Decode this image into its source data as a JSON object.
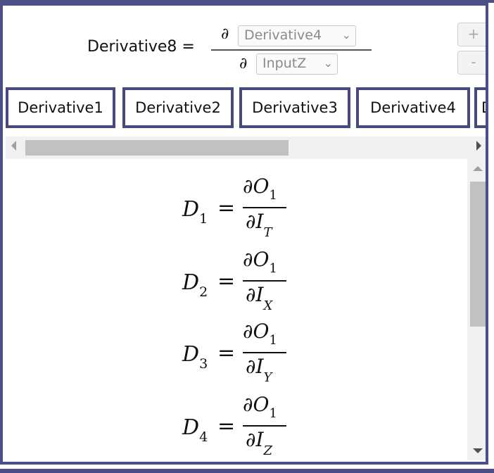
{
  "definition": {
    "name": "Derivative8 =",
    "partial_symbol": "∂",
    "numerator_select": "Derivative4",
    "denominator_select": "InputZ",
    "add_label": "+",
    "remove_label": "-"
  },
  "tabs": [
    {
      "label": "Derivative1"
    },
    {
      "label": "Derivative2"
    },
    {
      "label": "Derivative3"
    },
    {
      "label": "Derivative4"
    },
    {
      "label": "D"
    }
  ],
  "equations": [
    {
      "lhs": "D",
      "lhs_sub": "1",
      "eq": "=",
      "num": "∂O",
      "num_sub": "1",
      "den": "∂I",
      "den_sub": "T"
    },
    {
      "lhs": "D",
      "lhs_sub": "2",
      "eq": "=",
      "num": "∂O",
      "num_sub": "1",
      "den": "∂I",
      "den_sub": "X"
    },
    {
      "lhs": "D",
      "lhs_sub": "3",
      "eq": "=",
      "num": "∂O",
      "num_sub": "1",
      "den": "∂I",
      "den_sub": "Y"
    },
    {
      "lhs": "D",
      "lhs_sub": "4",
      "eq": "=",
      "num": "∂O",
      "num_sub": "1",
      "den": "∂I",
      "den_sub": "Z"
    }
  ],
  "colors": {
    "border": "#4b4f86",
    "scroll_track": "#f1f1f1",
    "scroll_thumb": "#c1c1c1"
  }
}
